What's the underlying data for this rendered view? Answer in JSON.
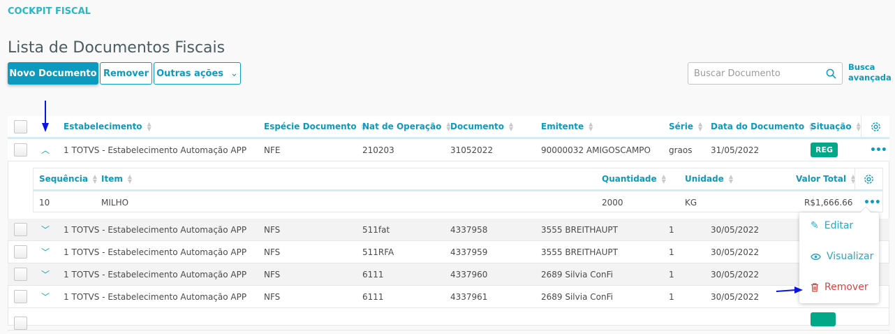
{
  "breadcrumb": "COCKPIT FISCAL",
  "page_title": "Lista de Documentos Fiscais",
  "actions": {
    "new": "Novo Documento",
    "remove": "Remover",
    "more": "Outras ações"
  },
  "search": {
    "placeholder": "Buscar Documento",
    "advanced_line1": "Busca",
    "advanced_line2": "avançada"
  },
  "columns": [
    "Estabelecimento",
    "Espécie Documento",
    "Nat de Operação",
    "Documento",
    "Emitente",
    "Série",
    "Data do Documento",
    "Situação"
  ],
  "rows": [
    {
      "estab": "1 TOTVS - Estabelecimento Automação APP",
      "especie": "NFE",
      "nat": "210203",
      "doc": "31052022",
      "emitente": "90000032 AMIGOSCAMPO",
      "serie": "graos",
      "data": "31/05/2022",
      "situacao": "REG"
    },
    {
      "estab": "1 TOTVS - Estabelecimento Automação APP",
      "especie": "NFS",
      "nat": "511fat",
      "doc": "4337958",
      "emitente": "3555 BREITHAUPT",
      "serie": "1",
      "data": "30/05/2022"
    },
    {
      "estab": "1 TOTVS - Estabelecimento Automação APP",
      "especie": "NFS",
      "nat": "511RFA",
      "doc": "4337959",
      "emitente": "3555 BREITHAUPT",
      "serie": "1",
      "data": "30/05/2022"
    },
    {
      "estab": "1 TOTVS - Estabelecimento Automação APP",
      "especie": "NFS",
      "nat": "6111",
      "doc": "4337960",
      "emitente": "2689 Silvia ConFi",
      "serie": "1",
      "data": "30/05/2022"
    },
    {
      "estab": "1 TOTVS - Estabelecimento Automação APP",
      "especie": "NFS",
      "nat": "6111",
      "doc": "4337961",
      "emitente": "2689 Silvia ConFi",
      "serie": "1",
      "data": "30/05/2022"
    }
  ],
  "detail": {
    "columns": [
      "Sequência",
      "Item",
      "Quantidade",
      "Unidade",
      "Valor Total"
    ],
    "row": {
      "seq": "10",
      "item": "MILHO",
      "qtd": "2000",
      "un": "KG",
      "valor": "R$1,666.66"
    }
  },
  "menu": {
    "edit": "Editar",
    "view": "Visualizar",
    "remove": "Remover"
  },
  "colors": {
    "primary": "#0c9abe",
    "success": "#00a887",
    "danger": "#d0463f",
    "annotation": "#0a14e6"
  }
}
